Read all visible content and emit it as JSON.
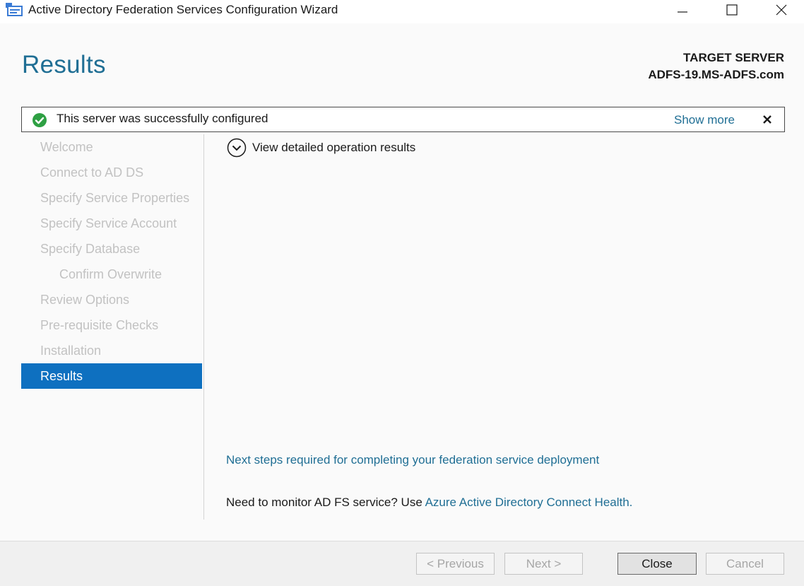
{
  "window": {
    "title": "Active Directory Federation Services Configuration Wizard",
    "icons": {
      "app": "adfs-app-icon",
      "minimize": "minimize-icon",
      "maximize": "maximize-icon",
      "close": "close-icon"
    }
  },
  "header": {
    "title": "Results",
    "target_label": "TARGET SERVER",
    "target_server": "ADFS-19.MS-ADFS.com"
  },
  "notification": {
    "message": "This server was successfully configured",
    "show_more": "Show more",
    "status_color": "#2ea043"
  },
  "sidebar": {
    "items": [
      {
        "label": "Welcome",
        "state": "disabled"
      },
      {
        "label": "Connect to AD DS",
        "state": "disabled"
      },
      {
        "label": "Specify Service Properties",
        "state": "disabled"
      },
      {
        "label": "Specify Service Account",
        "state": "disabled"
      },
      {
        "label": "Specify Database",
        "state": "disabled"
      },
      {
        "label": "Confirm Overwrite",
        "state": "disabled",
        "sub": true
      },
      {
        "label": "Review Options",
        "state": "disabled"
      },
      {
        "label": "Pre-requisite Checks",
        "state": "disabled"
      },
      {
        "label": "Installation",
        "state": "disabled"
      },
      {
        "label": "Results",
        "state": "active"
      }
    ],
    "active_color": "#0e70c0"
  },
  "main": {
    "details_label": "View detailed operation results",
    "next_steps_link": "Next steps required for completing your federation service deployment",
    "monitor_prefix": "Need to monitor AD FS service? Use ",
    "monitor_link": "Azure Active Directory Connect Health."
  },
  "footer": {
    "previous": "< Previous",
    "next": "Next >",
    "close": "Close",
    "cancel": "Cancel"
  }
}
